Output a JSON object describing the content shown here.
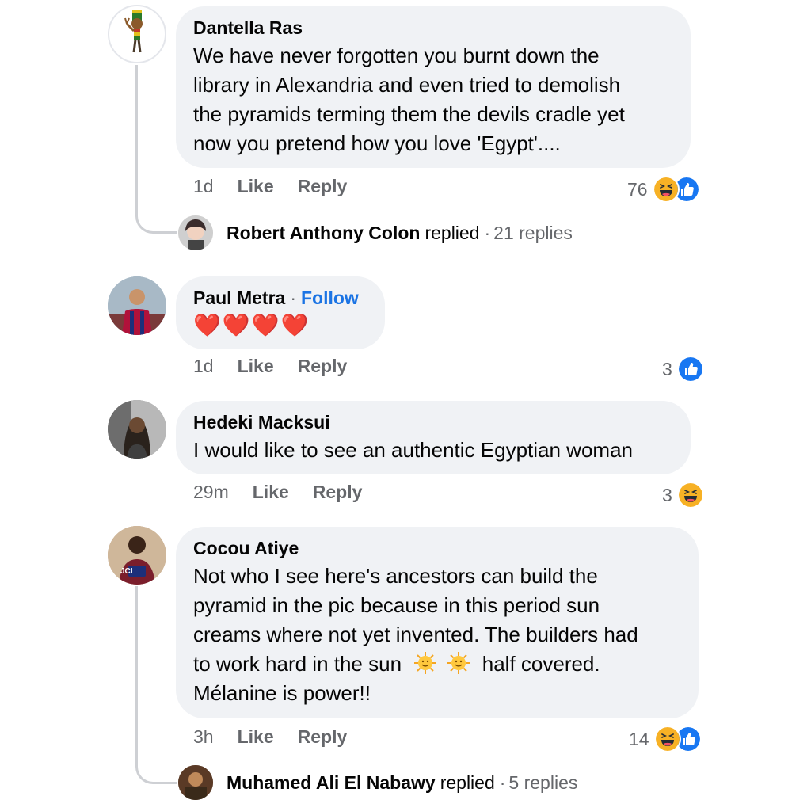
{
  "comments": [
    {
      "author": "Dantella Ras",
      "lines": [
        "We have never forgotten you burnt down the",
        "library in Alexandria and even tried to demolish",
        "the pyramids terming them the devils cradle yet",
        "now you pretend how you love 'Egypt'...."
      ],
      "time": "1d",
      "like": "Like",
      "reply": "Reply",
      "reactions": "76",
      "reaction_icons": [
        "haha-icon",
        "like-icon"
      ],
      "replied_by": "Robert Anthony Colon",
      "replied_word": "replied",
      "replied_count": "21 replies"
    },
    {
      "author": "Paul Metra",
      "follow": "Follow",
      "hearts": "❤️❤️❤️❤️",
      "time": "1d",
      "like": "Like",
      "reply": "Reply",
      "reactions": "3",
      "reaction_icons": [
        "like-icon"
      ]
    },
    {
      "author": "Hedeki Macksui",
      "lines": [
        "I would like to see an authentic Egyptian woman"
      ],
      "time": "29m",
      "like": "Like",
      "reply": "Reply",
      "reactions": "3",
      "reaction_icons": [
        "haha-icon"
      ]
    },
    {
      "author": "Cocou Atiye",
      "lines": [
        "Not who I see here's ancestors can build the",
        "pyramid in the pic because in this period sun",
        "creams where not yet invented. The builders had",
        "to work hard in the sun",
        "half covered.",
        "Mélanine is power!!"
      ],
      "avatar_text": "JCI",
      "time": "3h",
      "like": "Like",
      "reply": "Reply",
      "reactions": "14",
      "reaction_icons": [
        "haha-icon",
        "like-icon"
      ],
      "replied_by": "Muhamed Ali El Nabawy",
      "replied_word": "replied",
      "replied_count": "5 replies"
    }
  ],
  "colors": {
    "bubble": "#f0f2f5",
    "meta": "#65676b",
    "follow": "#1b74e4",
    "like": "#1b74e4",
    "haha": "#f7b125"
  }
}
